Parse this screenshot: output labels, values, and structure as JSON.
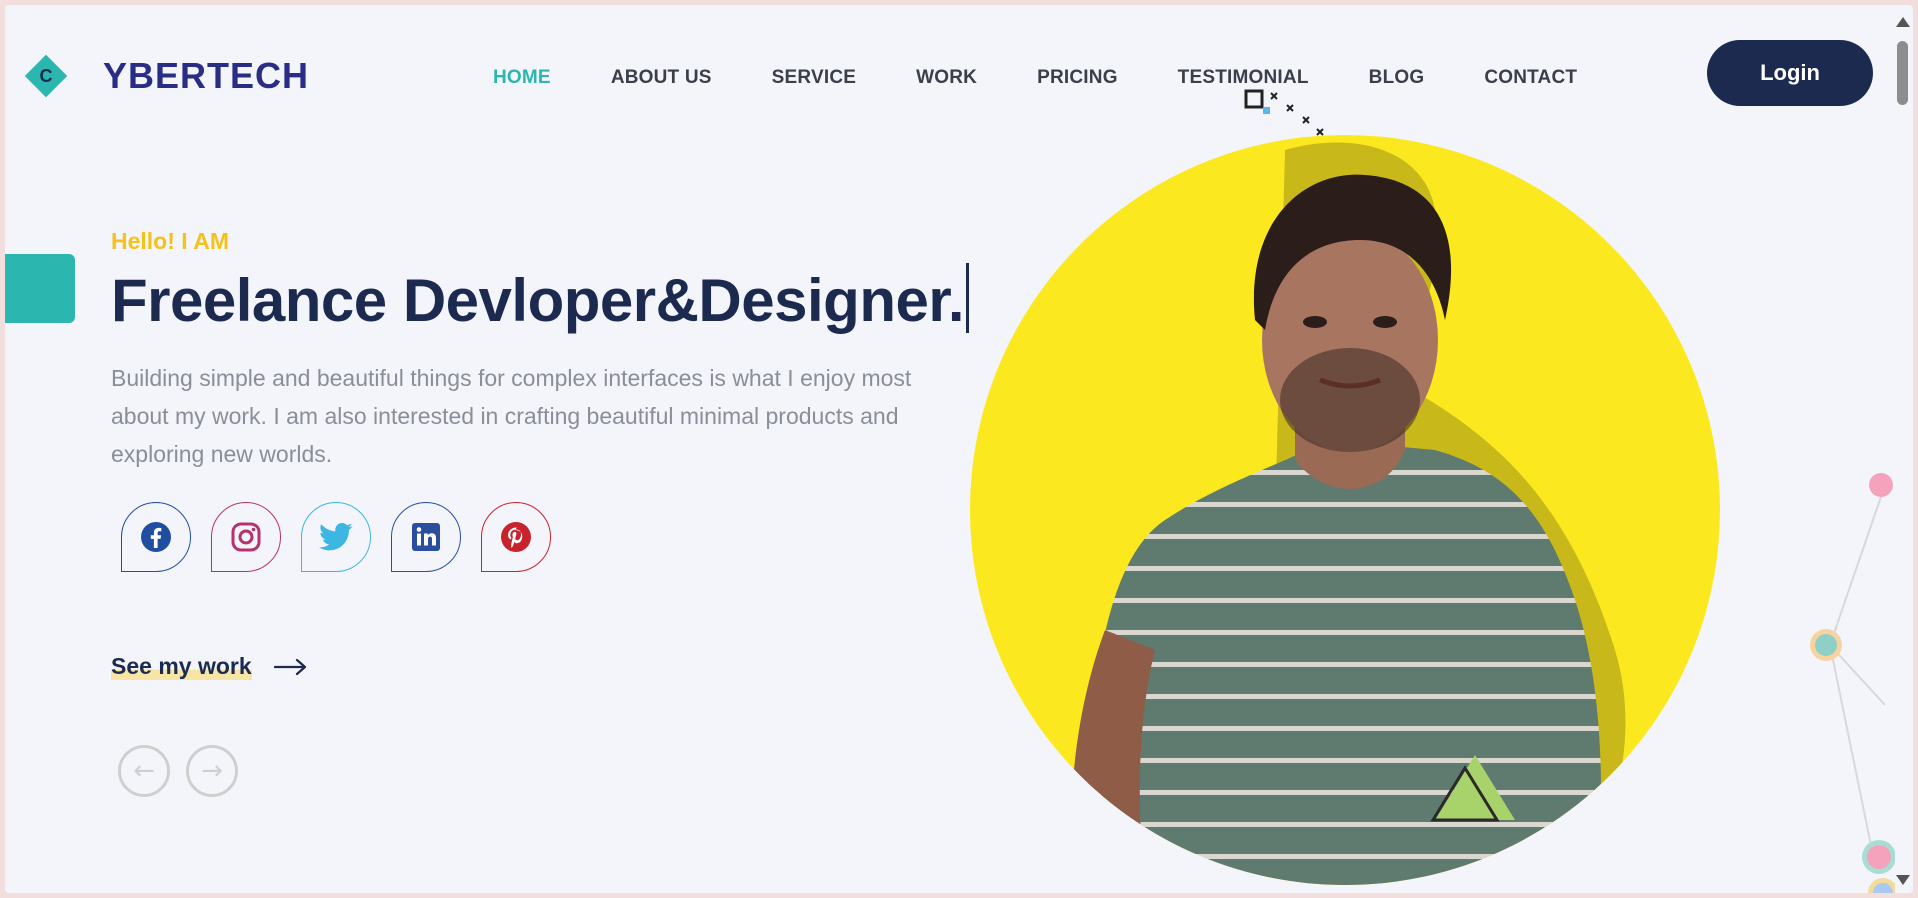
{
  "brand": {
    "mark": "C",
    "name": "YBERTECH"
  },
  "nav": {
    "items": [
      {
        "label": "HOME",
        "active": true
      },
      {
        "label": "ABOUT US"
      },
      {
        "label": "SERVICE"
      },
      {
        "label": "WORK"
      },
      {
        "label": "PRICING"
      },
      {
        "label": "TESTIMONIAL"
      },
      {
        "label": "BLOG"
      },
      {
        "label": "CONTACT"
      }
    ],
    "login_label": "Login"
  },
  "hero": {
    "greeting": "Hello! I AM",
    "headline": "Freelance Devloper&Designer.",
    "description": "Building simple and beautiful things for complex interfaces is what I enjoy most about my work. I am also interested in crafting beautiful minimal products and exploring new worlds.",
    "see_work_label": "See my work",
    "pager": {
      "prev_glyph": "←",
      "next_glyph": "→"
    }
  },
  "socials": [
    {
      "name": "facebook",
      "color": "#1f4ea1"
    },
    {
      "name": "instagram",
      "color": "#b5326e"
    },
    {
      "name": "twitter",
      "color": "#3cb6e3"
    },
    {
      "name": "linkedin",
      "color": "#2a4f9f"
    },
    {
      "name": "pinterest",
      "color": "#c8232c"
    }
  ],
  "colors": {
    "accent": "#2bb7b0",
    "navy": "#1b2a4e",
    "yellow": "#f4c21b",
    "circle": "#fbe81f"
  }
}
